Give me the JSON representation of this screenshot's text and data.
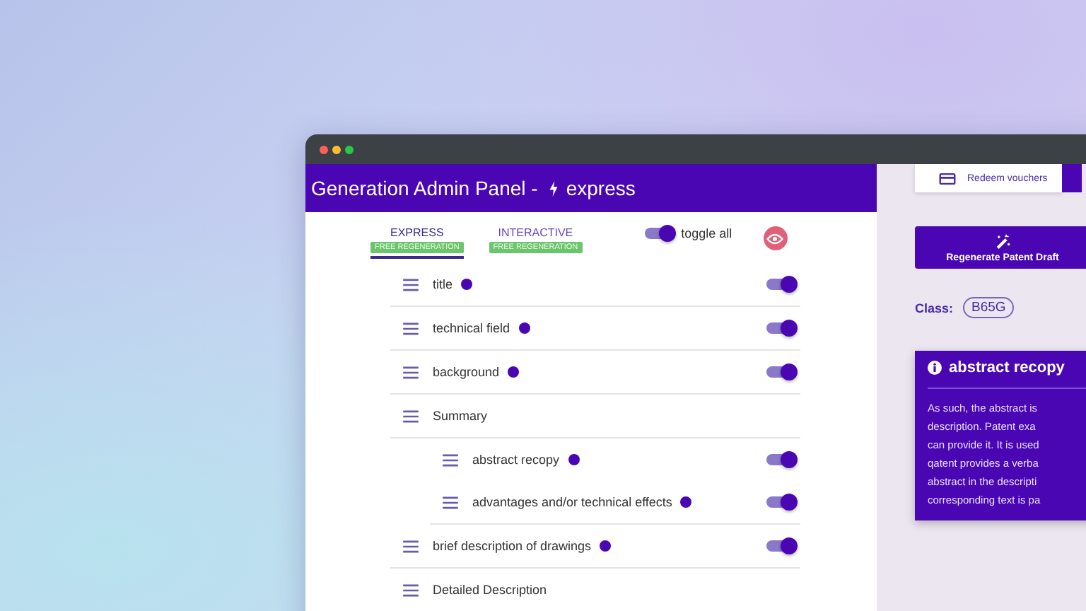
{
  "window": {
    "title": "Generation Admin Panel -",
    "mode": "express"
  },
  "modes": [
    {
      "label": "EXPRESS",
      "badge": "FREE REGENERATION",
      "selected": true
    },
    {
      "label": "INTERACTIVE",
      "badge": "FREE REGENERATION",
      "selected": false
    }
  ],
  "toggle_all": {
    "label": "toggle all",
    "on": true
  },
  "sections": [
    {
      "label": "title",
      "kind": "toggle",
      "on": true
    },
    {
      "label": "technical field",
      "kind": "toggle",
      "on": true
    },
    {
      "label": "background",
      "kind": "toggle",
      "on": true
    },
    {
      "label": "Summary",
      "kind": "group",
      "children": [
        {
          "label": "abstract recopy",
          "kind": "toggle",
          "on": true
        },
        {
          "label": "advantages and/or technical effects",
          "kind": "toggle",
          "on": true
        }
      ]
    },
    {
      "label": "brief description of drawings",
      "kind": "toggle",
      "on": true
    },
    {
      "label": "Detailed Description",
      "kind": "group"
    }
  ],
  "sidebar": {
    "redeem_button": "Redeem vouchers",
    "regenerate_button": "Regenerate Patent Draft",
    "class_label": "Class:",
    "class_value": "B65G",
    "info_card": {
      "title": "abstract recopy",
      "lines": [
        "As such, the abstract is",
        "description. Patent exa",
        "can provide it. It is used",
        "qatent provides a verba",
        "abstract in the descripti",
        "corresponding text is pa"
      ]
    }
  }
}
